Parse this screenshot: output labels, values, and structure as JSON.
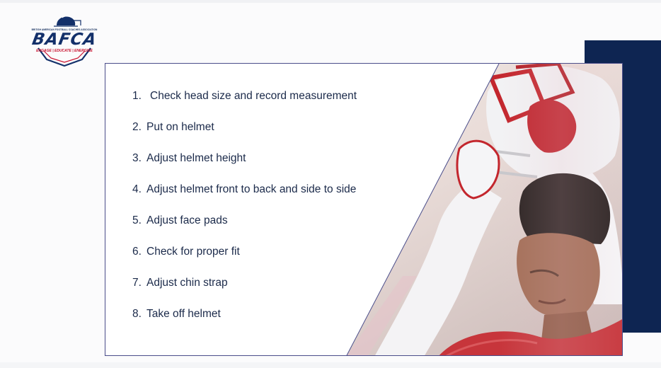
{
  "logo": {
    "icon": "football-helmet-crest-icon",
    "association_line": "BRITISH AMERICAN FOOTBALL COACHES ASSOCIATION",
    "brand": "BAFCA",
    "tagline": "ENGAGE | EDUCATE | ENERGISE"
  },
  "slide": {
    "steps": [
      {
        "number": "1.",
        "text": "Check head size and record measurement"
      },
      {
        "number": "2.",
        "text": "Put on helmet"
      },
      {
        "number": "3.",
        "text": "Adjust helmet height"
      },
      {
        "number": "4.",
        "text": "Adjust helmet front to back and side to side"
      },
      {
        "number": "5.",
        "text": "Adjust face pads"
      },
      {
        "number": "6.",
        "text": "Check for proper fit"
      },
      {
        "number": "7.",
        "text": "Adjust chin strap"
      },
      {
        "number": "8.",
        "text": "Take off helmet"
      }
    ],
    "photo": "player-adjusting-helmet-photo"
  },
  "colors": {
    "navy": "#0e2552",
    "brand_red": "#c8102e",
    "text": "#1b2a4a",
    "frame": "#4a4d8a"
  }
}
